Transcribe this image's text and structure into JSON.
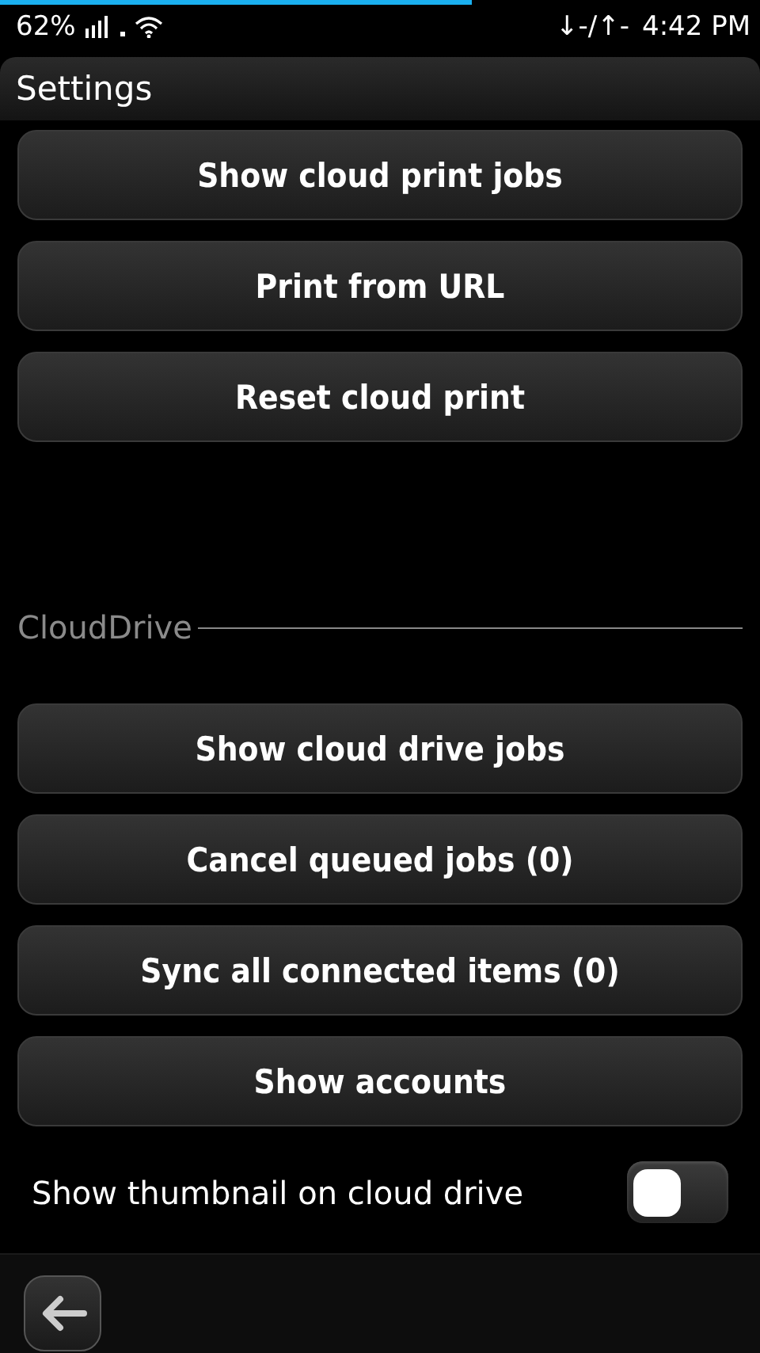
{
  "status_bar": {
    "battery": "62%",
    "battery_level": {
      "level": 0.62
    },
    "transfer": "↓-/↑-",
    "time": "4:42 PM"
  },
  "title": "Settings",
  "print_buttons": [
    "Show cloud print jobs",
    "Print from URL",
    "Reset cloud print"
  ],
  "section": {
    "title": "CloudDrive"
  },
  "drive_buttons": [
    "Show cloud drive jobs",
    "Cancel queued jobs (0)",
    "Sync all connected items (0)",
    "Show accounts"
  ],
  "toggle": {
    "label": "Show thumbnail on cloud drive",
    "on": false
  }
}
